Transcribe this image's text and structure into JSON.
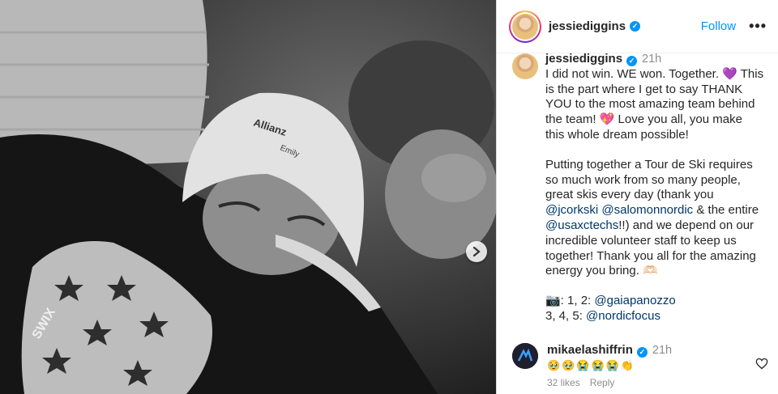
{
  "post": {
    "username": "jessiediggins",
    "follow_label": "Follow",
    "more_icon": "•••",
    "verified_icon": "✓",
    "time": "21h",
    "caption_p1": "I did not win. WE won. Together. 💜 This is the part where I get to say THANK YOU to the most amazing team behind the team! 💖 Love you all, you make this whole dream possible!",
    "caption_p2_a": "Putting together a Tour de Ski requires so much work from so many people, great skis every day (thank you ",
    "mention_1": "@jcorkski",
    "mention_2": "@salomonnordic",
    "caption_p2_b": " & the entire ",
    "mention_3": "@usaxctechs",
    "caption_p2_c": "!!) and we depend on our incredible volunteer staff to keep us together! Thank you all for the amazing energy you bring. 🫶🏻",
    "credit_1_prefix": "📷: 1, 2: ",
    "credit_1_mention": "@gaiapanozzo",
    "credit_2_prefix": "3, 4, 5: ",
    "credit_2_mention": "@nordicfocus"
  },
  "comment": {
    "username": "mikaelashiffrin",
    "time": "21h",
    "emojis": "🥹🥹😭😭😭👏",
    "likes": "32 likes",
    "reply": "Reply"
  },
  "photo": {
    "hat_text_1": "Allianz",
    "hat_text_2": "Emily",
    "sleeve_text": "SWIX"
  },
  "icons": {
    "next": "next-arrow-icon",
    "heart": "heart-icon",
    "verified": "verified-badge-icon",
    "more": "more-options-icon"
  }
}
